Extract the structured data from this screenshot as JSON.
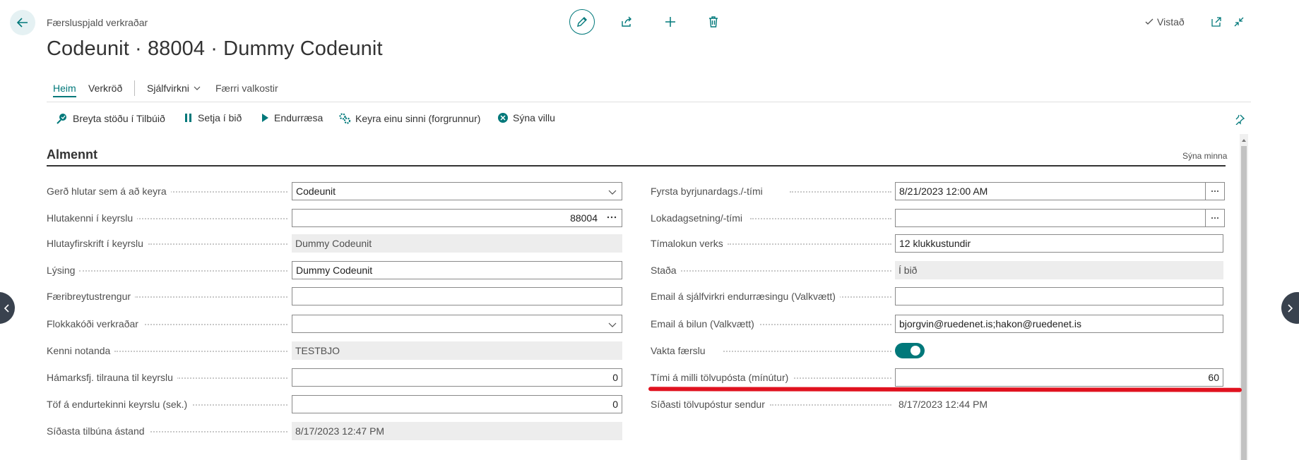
{
  "header": {
    "breadcrumb": "Færsluspjald verkraðar",
    "title": "Codeunit · 88004 · Dummy Codeunit",
    "saved_label": "Vistað"
  },
  "tabs": {
    "home": "Heim",
    "tools": "Verkröð",
    "automation": "Sjálfvirkni",
    "fewer": "Færri valkostir"
  },
  "actions": {
    "set_ready": "Breyta stöðu í Tilbúið",
    "set_on_hold": "Setja í bið",
    "restart": "Endurræsa",
    "run_once": "Keyra einu sinni (forgrunnur)",
    "show_error": "Sýna villu"
  },
  "section": {
    "title": "Almennt",
    "show_less": "Sýna minna"
  },
  "left_fields": [
    {
      "label": "Gerð hlutar sem á að keyra",
      "value": "Codeunit"
    },
    {
      "label": "Hlutakenni í keyrslu",
      "value": "88004"
    },
    {
      "label": "Hlutayfirskrift í keyrslu",
      "value": "Dummy Codeunit"
    },
    {
      "label": "Lýsing",
      "value": "Dummy Codeunit"
    },
    {
      "label": "Færibreytustrengur",
      "value": ""
    },
    {
      "label": "Flokkakóði verkraðar",
      "value": ""
    },
    {
      "label": "Kenni notanda",
      "value": "TESTBJO"
    },
    {
      "label": "Hámarksfj. tilrauna til keyrslu",
      "value": "0"
    },
    {
      "label": "Töf á endurtekinni keyrslu (sek.)",
      "value": "0"
    },
    {
      "label": "Síðasta tilbúna ástand",
      "value": "8/17/2023 12:47 PM"
    }
  ],
  "right_fields": [
    {
      "label": "Fyrsta byrjunardags./-tími",
      "value": "8/21/2023 12:00 AM"
    },
    {
      "label": "Lokadagsetning/-tími",
      "value": ""
    },
    {
      "label": "Tímalokun verks",
      "value": "12 klukkustundir"
    },
    {
      "label": "Staða",
      "value": "Í bið"
    },
    {
      "label": "Email á sjálfvirkri endurræsingu (Valkvætt)",
      "value": ""
    },
    {
      "label": "Email á bilun (Valkvætt)",
      "value": "bjorgvin@ruedenet.is;hakon@ruedenet.is"
    },
    {
      "label": "Vakta færslu",
      "value": true
    },
    {
      "label": "Tími á milli tölvupósta (mínútur)",
      "value": "60"
    },
    {
      "label": "Síðasti tölvupóstur sendur",
      "value": "8/17/2023 12:44 PM"
    }
  ],
  "colors": {
    "accent": "#00787a",
    "annotation": "#e0121f"
  }
}
